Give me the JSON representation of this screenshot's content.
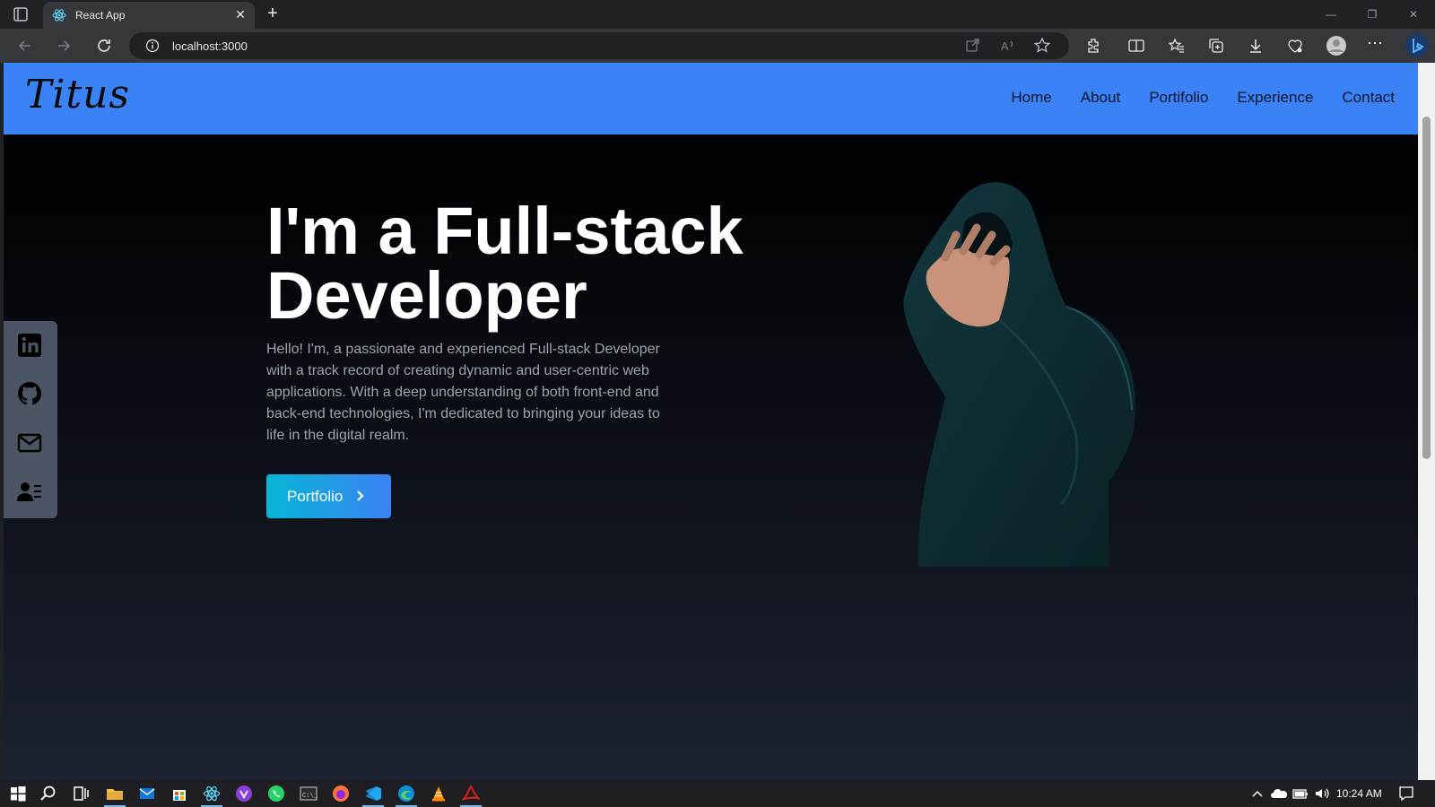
{
  "browser": {
    "tab_title": "React App",
    "url": "localhost:3000",
    "icons": [
      "tab-list-icon",
      "react-favicon",
      "close-icon",
      "new-tab-icon",
      "back-icon",
      "forward-icon",
      "refresh-icon",
      "info-icon",
      "open-in-app-icon",
      "read-aloud-icon",
      "favorite-star-icon",
      "extensions-icon",
      "split-screen-icon",
      "favorites-icon",
      "collections-icon",
      "downloads-icon",
      "browser-essentials-icon",
      "profile-icon",
      "more-icon",
      "bing-icon"
    ]
  },
  "site": {
    "logo": "Titus",
    "nav": [
      "Home",
      "About",
      "Portifolio",
      "Experience",
      "Contact"
    ],
    "social_icons": [
      "linkedin-icon",
      "github-icon",
      "mail-icon",
      "resume-icon"
    ]
  },
  "hero": {
    "title_line1": "I'm a Full-stack",
    "title_line2": "Developer",
    "text": "Hello! I'm, a passionate and experienced Full-stack Developer with a track record of creating dynamic and user-centric web applications. With a deep understanding of both front-end and back-end technologies, I'm dedicated to bringing your ideas to life in the digital realm.",
    "cta_label": "Portfolio",
    "accent": "#3b82f6",
    "cta_gradient": [
      "#06b6d4",
      "#3b82f6"
    ]
  },
  "taskbar": {
    "clock": "10:24 AM",
    "apps": [
      "windows-start-icon",
      "search-icon",
      "task-view-icon",
      "file-explorer-icon",
      "mail-icon",
      "store-icon",
      "react-devtools-icon",
      "brave-icon",
      "whatsapp-icon",
      "terminal-icon",
      "firefox-icon",
      "vscode-icon",
      "edge-icon",
      "vlc-icon",
      "acrobat-icon"
    ],
    "tray": [
      "chevron-up-icon",
      "onedrive-icon",
      "battery-icon",
      "volume-icon",
      "notification-icon"
    ]
  }
}
